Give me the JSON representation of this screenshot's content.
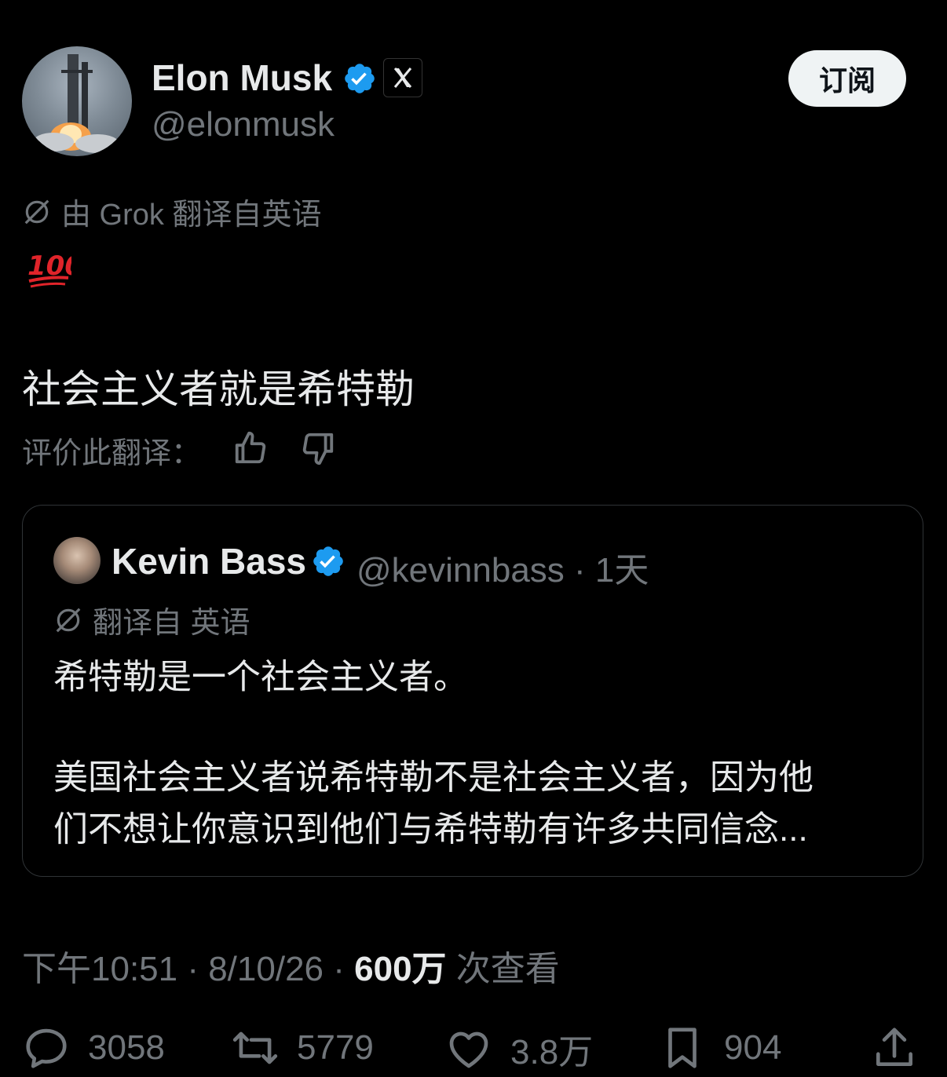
{
  "author": {
    "name": "Elon Musk",
    "handle": "@elonmusk",
    "verified_color": "#1d9bf0"
  },
  "subscribe_label": "订阅",
  "translation_note": "由 Grok 翻译自英语",
  "emoji": "💯",
  "tweet_text": "社会主义者就是希特勒",
  "rate_label": "评价此翻译：",
  "quoted": {
    "name": "Kevin Bass",
    "handle": "@kevinnbass · 1天",
    "translation_note": "翻译自 英语",
    "line1": "希特勒是一个社会主义者。",
    "line2": "美国社会主义者说希特勒不是社会主义者，因为他",
    "line3": "们不想让你意识到他们与希特勒有许多共同信念..."
  },
  "meta": {
    "time": "下午10:51 · 8/10/26 · ",
    "views": "600万",
    "views_suffix": " 次查看"
  },
  "actions": {
    "replies": "3058",
    "retweets": "5779",
    "likes": "3.8万",
    "bookmarks": "904"
  }
}
